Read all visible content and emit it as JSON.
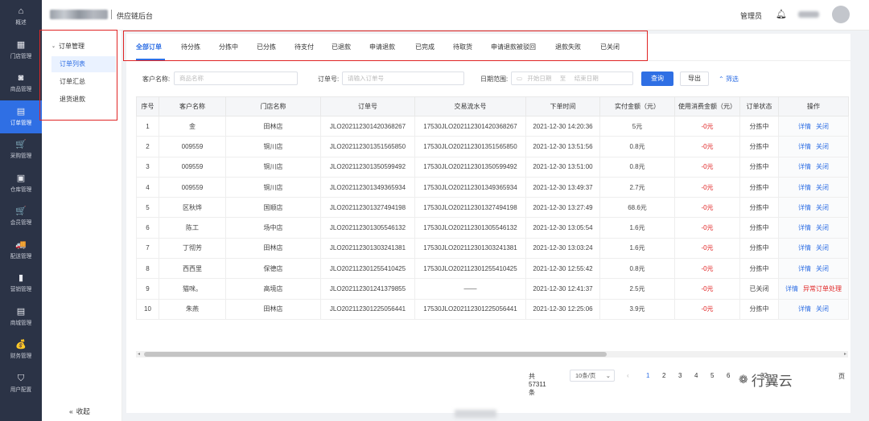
{
  "nav": [
    {
      "icon": "⌂",
      "icon_name": "home-icon",
      "label": "概述"
    },
    {
      "icon": "▦",
      "icon_name": "store-icon",
      "label": "门店管理"
    },
    {
      "icon": "◙",
      "icon_name": "product-icon",
      "label": "商品管理"
    },
    {
      "icon": "▤",
      "icon_name": "order-icon",
      "label": "订单管理"
    },
    {
      "icon": "🛒",
      "icon_name": "cart-icon",
      "label": "采购管理"
    },
    {
      "icon": "▣",
      "icon_name": "warehouse-icon",
      "label": "仓库管理"
    },
    {
      "icon": "🛒",
      "icon_name": "member-cart-icon",
      "label": "会员管理"
    },
    {
      "icon": "🚚",
      "icon_name": "truck-icon",
      "label": "配送管理"
    },
    {
      "icon": "▮",
      "icon_name": "bar-chart-icon",
      "label": "营销管理"
    },
    {
      "icon": "▤",
      "icon_name": "mall-icon",
      "label": "商城管理"
    },
    {
      "icon": "💰",
      "icon_name": "money-bag-icon",
      "label": "财务管理"
    },
    {
      "icon": "⛉",
      "icon_name": "shield-icon",
      "label": "用户配置"
    }
  ],
  "topbar": {
    "title": "供应链后台",
    "admin": "管理员"
  },
  "submenu": {
    "group": "订单管理",
    "items": [
      "订单列表",
      "订单汇总",
      "退货退款"
    ],
    "collapse": "收起"
  },
  "tabs": [
    "全部订单",
    "待分拣",
    "分拣中",
    "已分拣",
    "待支付",
    "已退款",
    "申请退款",
    "已完成",
    "待取货",
    "申请退款被驳回",
    "退款失败",
    "已关闭"
  ],
  "filter": {
    "customer_label": "客户名称:",
    "customer_placeholder": "商品名称",
    "order_label": "订单号:",
    "order_placeholder": "请输入订单号",
    "date_label": "日期范围:",
    "start_placeholder": "开始日期",
    "date_sep": "至",
    "end_placeholder": "结束日期",
    "search": "查询",
    "export": "导出",
    "more": "筛选"
  },
  "table": {
    "headers": [
      "序号",
      "客户名称",
      "门店名称",
      "订单号",
      "交易流水号",
      "下单时间",
      "实付金额（元）",
      "使用消费金额（元）",
      "订单状态",
      "操作"
    ],
    "rows": [
      [
        "1",
        "金",
        "田林店",
        "JLO202112301420368267",
        "17530JLO202112301420368267",
        "2021-12-30 14:20:36",
        "5元",
        "-0元",
        "分拣中"
      ],
      [
        "2",
        "009559",
        "铜川店",
        "JLO202112301351565850",
        "17530JLO202112301351565850",
        "2021-12-30 13:51:56",
        "0.8元",
        "-0元",
        "分拣中"
      ],
      [
        "3",
        "009559",
        "铜川店",
        "JLO202112301350599492",
        "17530JLO202112301350599492",
        "2021-12-30 13:51:00",
        "0.8元",
        "-0元",
        "分拣中"
      ],
      [
        "4",
        "009559",
        "铜川店",
        "JLO202112301349365934",
        "17530JLO202112301349365934",
        "2021-12-30 13:49:37",
        "2.7元",
        "-0元",
        "分拣中"
      ],
      [
        "5",
        "区秋烨",
        "国顺店",
        "JLO202112301327494198",
        "17530JLO202112301327494198",
        "2021-12-30 13:27:49",
        "68.6元",
        "-0元",
        "分拣中"
      ],
      [
        "6",
        "陈工",
        "场中店",
        "JLO202112301305546132",
        "17530JLO202112301305546132",
        "2021-12-30 13:05:54",
        "1.6元",
        "-0元",
        "分拣中"
      ],
      [
        "7",
        "丁彻芳",
        "田林店",
        "JLO202112301303241381",
        "17530JLO202112301303241381",
        "2021-12-30 13:03:24",
        "1.6元",
        "-0元",
        "分拣中"
      ],
      [
        "8",
        "西西里",
        "保德店",
        "JLO202112301255410425",
        "17530JLO202112301255410425",
        "2021-12-30 12:55:42",
        "0.8元",
        "-0元",
        "分拣中"
      ],
      [
        "9",
        "猫咪。",
        "高境店",
        "JLO202112301241379855",
        "——",
        "2021-12-30 12:41:37",
        "2.5元",
        "-0元",
        "已关闭"
      ],
      [
        "10",
        "朱燕",
        "田林店",
        "JLO202112301225056441",
        "17530JLO202112301225056441",
        "2021-12-30 12:25:06",
        "3.9元",
        "-0元",
        "分拣中"
      ]
    ],
    "op_detail": "详情",
    "op_close": "关闭",
    "op_abnormal": "异常订单处理"
  },
  "pager": {
    "total": "共 57311 条",
    "size": "10条/页",
    "prev": "‹",
    "pages": [
      "1",
      "2",
      "3",
      "4",
      "5",
      "6"
    ],
    "last_partial": "32",
    "tail": "页"
  },
  "watermark": "行翼云",
  "colors": {
    "primary": "#2f6fe4",
    "danger": "#e02424",
    "nav_bg": "#2b3346"
  }
}
